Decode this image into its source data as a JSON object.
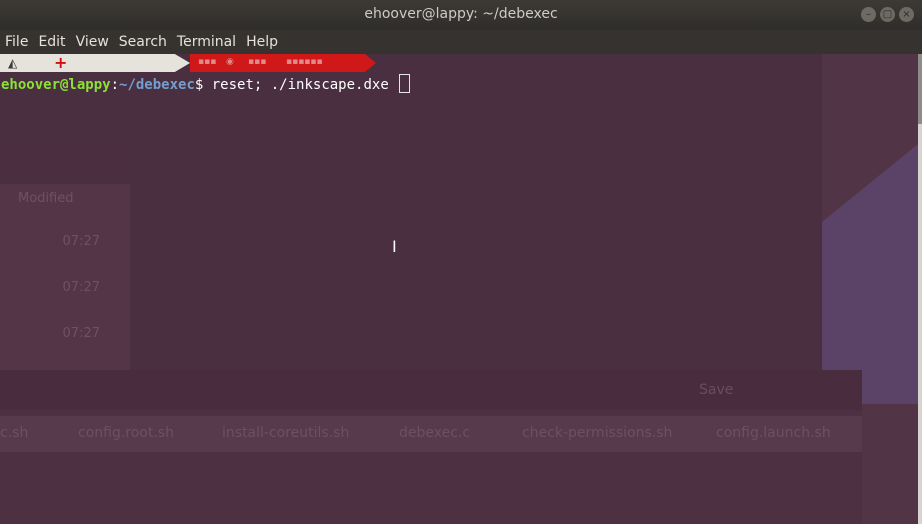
{
  "window": {
    "title": "ehoover@lappy: ~/debexec",
    "controls": [
      "minimize",
      "maximize",
      "close"
    ]
  },
  "menu": {
    "items": [
      "File",
      "Edit",
      "View",
      "Search",
      "Terminal",
      "Help"
    ]
  },
  "prompt": {
    "user_host": "ehoover@lappy",
    "sep": ":",
    "path": "~/debexec",
    "symbol": "$",
    "command": " reset; ./inkscape.dxe"
  },
  "background_windows": {
    "file_list": {
      "column_header": "Modified",
      "times": [
        "07:27",
        "07:27",
        "07:27"
      ]
    },
    "editor": {
      "save_label": "Save",
      "tabs": [
        "c.sh",
        "config.root.sh",
        "install-coreutils.sh",
        "debexec.c",
        "check-permissions.sh",
        "config.launch.sh"
      ]
    }
  },
  "colors": {
    "terminal_bg": "#4a2f40",
    "user_green": "#8ae234",
    "path_blue": "#729fcf",
    "status_red": "#d01818"
  }
}
